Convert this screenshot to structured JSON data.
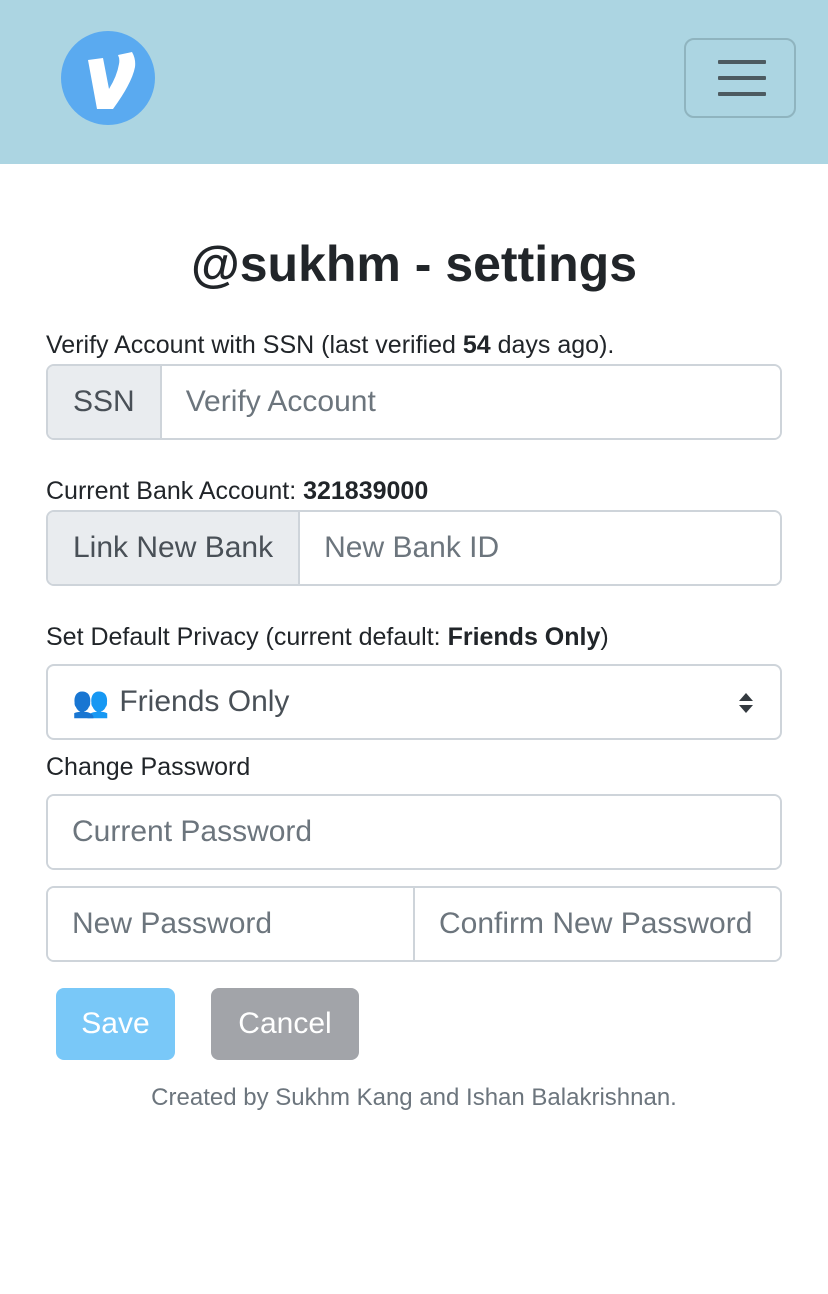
{
  "colors": {
    "navbar": "#acd5e2",
    "logo": "#5aaaf0",
    "save_button": "#79c8f8",
    "cancel_button": "#a2a4a9"
  },
  "navbar": {
    "logo_icon": "venmo-v-icon",
    "menu_icon": "hamburger-icon"
  },
  "page": {
    "title": "@sukhm - settings"
  },
  "ssn": {
    "label_prefix": "Verify Account with SSN (last verified ",
    "days": "54",
    "label_suffix": " days ago).",
    "addon": "SSN",
    "placeholder": "Verify Account"
  },
  "bank": {
    "label_prefix": "Current Bank Account: ",
    "account_number": "321839000",
    "addon": "Link New Bank",
    "placeholder": "New Bank ID"
  },
  "privacy": {
    "label_prefix": "Set Default Privacy (current default: ",
    "current": "Friends Only",
    "label_suffix": ")",
    "selected_icon": "👥",
    "selected_value": "Friends Only"
  },
  "password": {
    "label": "Change Password",
    "current_placeholder": "Current Password",
    "new_placeholder": "New Password",
    "confirm_placeholder": "Confirm New Password"
  },
  "actions": {
    "save_label": "Save",
    "cancel_label": "Cancel"
  },
  "footer": {
    "text": "Created by Sukhm Kang and Ishan Balakrishnan."
  }
}
